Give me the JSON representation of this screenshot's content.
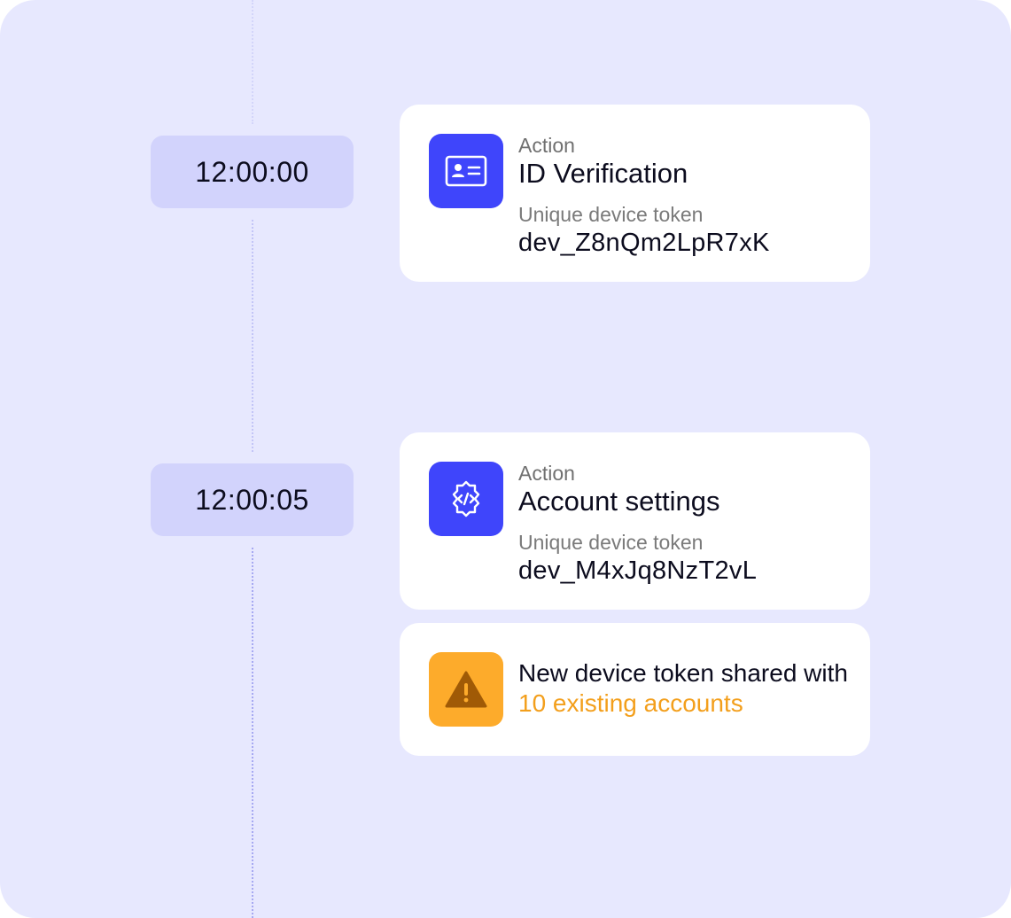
{
  "colors": {
    "background": "#e7e8fe",
    "time_pill": "#d2d3fc",
    "action_icon_bg": "#3f45fb",
    "alert_icon_bg": "#fdab2b",
    "alert_highlight": "#f39f1c"
  },
  "timeline": [
    {
      "time": "12:00:00",
      "card": {
        "icon": "id-card-icon",
        "eyebrow": "Action",
        "title": "ID Verification",
        "token_label": "Unique device token",
        "token": "dev_Z8nQm2LpR7xK"
      }
    },
    {
      "time": "12:00:05",
      "card": {
        "icon": "code-gear-icon",
        "eyebrow": "Action",
        "title": "Account settings",
        "token_label": "Unique device token",
        "token": "dev_M4xJq8NzT2vL"
      },
      "alert": {
        "icon": "warning-icon",
        "text_before": "New device token shared with ",
        "highlight": "10 existing accounts"
      }
    }
  ]
}
